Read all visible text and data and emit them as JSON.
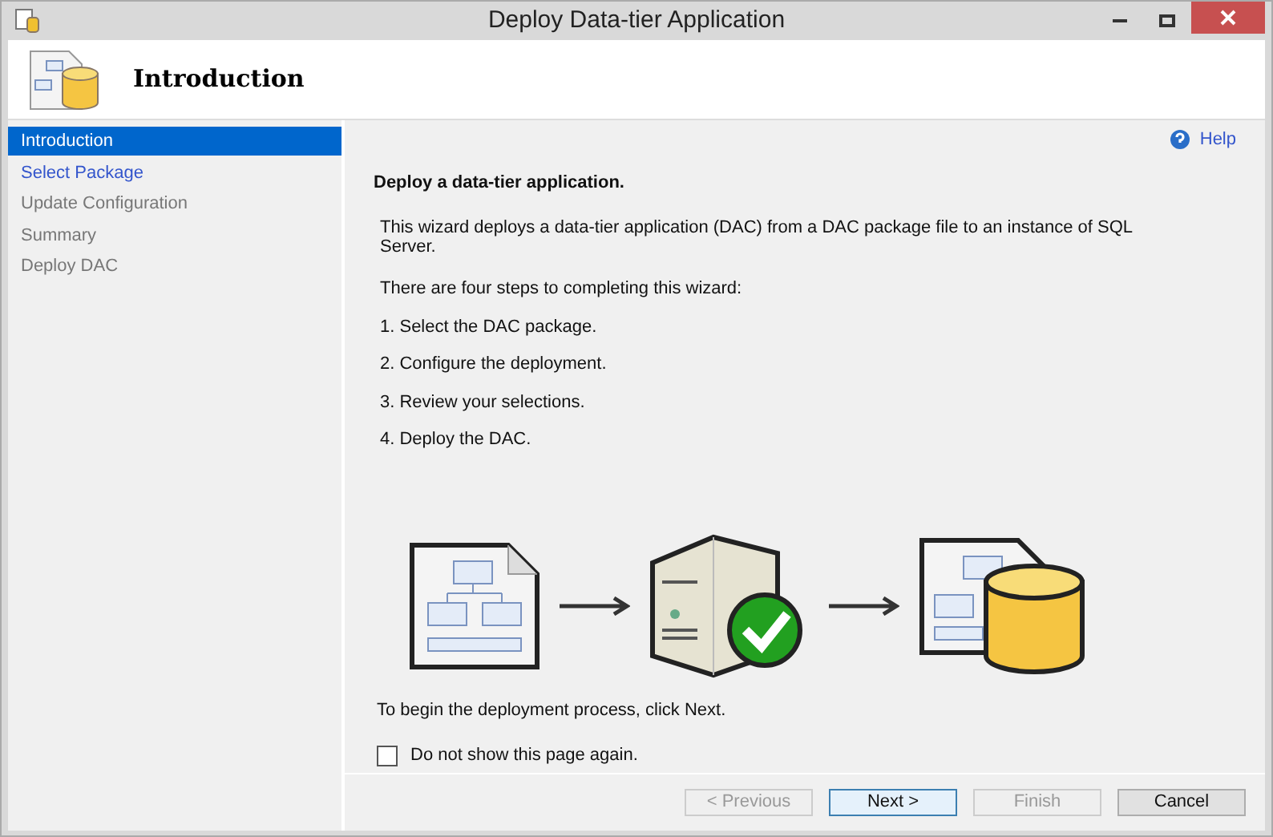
{
  "window": {
    "title": "Deploy Data-tier Application"
  },
  "header": {
    "title": "Introduction"
  },
  "sidebar": {
    "items": [
      {
        "label": "Introduction",
        "selected": true,
        "disabled": false
      },
      {
        "label": "Select Package",
        "selected": false,
        "disabled": false
      },
      {
        "label": "Update Configuration",
        "selected": false,
        "disabled": true
      },
      {
        "label": "Summary",
        "selected": false,
        "disabled": true
      },
      {
        "label": "Deploy DAC",
        "selected": false,
        "disabled": true
      }
    ]
  },
  "help": {
    "label": "Help"
  },
  "content": {
    "heading": "Deploy a data-tier application.",
    "intro": "This wizard deploys a data-tier application (DAC) from a DAC package file to an instance of SQL Server.",
    "steps_intro": "There are four steps to completing this wizard:",
    "steps": [
      "1. Select the DAC package.",
      "2. Configure the deployment.",
      "3. Review your selections.",
      "4. Deploy the DAC."
    ],
    "begin": "To begin the deployment process, click Next."
  },
  "checkbox": {
    "label": "Do not show this page again.",
    "checked": false
  },
  "buttons": [
    {
      "label": "< Previous",
      "disabled": true,
      "default": false
    },
    {
      "label": "Next >",
      "disabled": false,
      "default": true
    },
    {
      "label": "Finish",
      "disabled": true,
      "default": false
    },
    {
      "label": "Cancel",
      "disabled": false,
      "default": false
    }
  ]
}
